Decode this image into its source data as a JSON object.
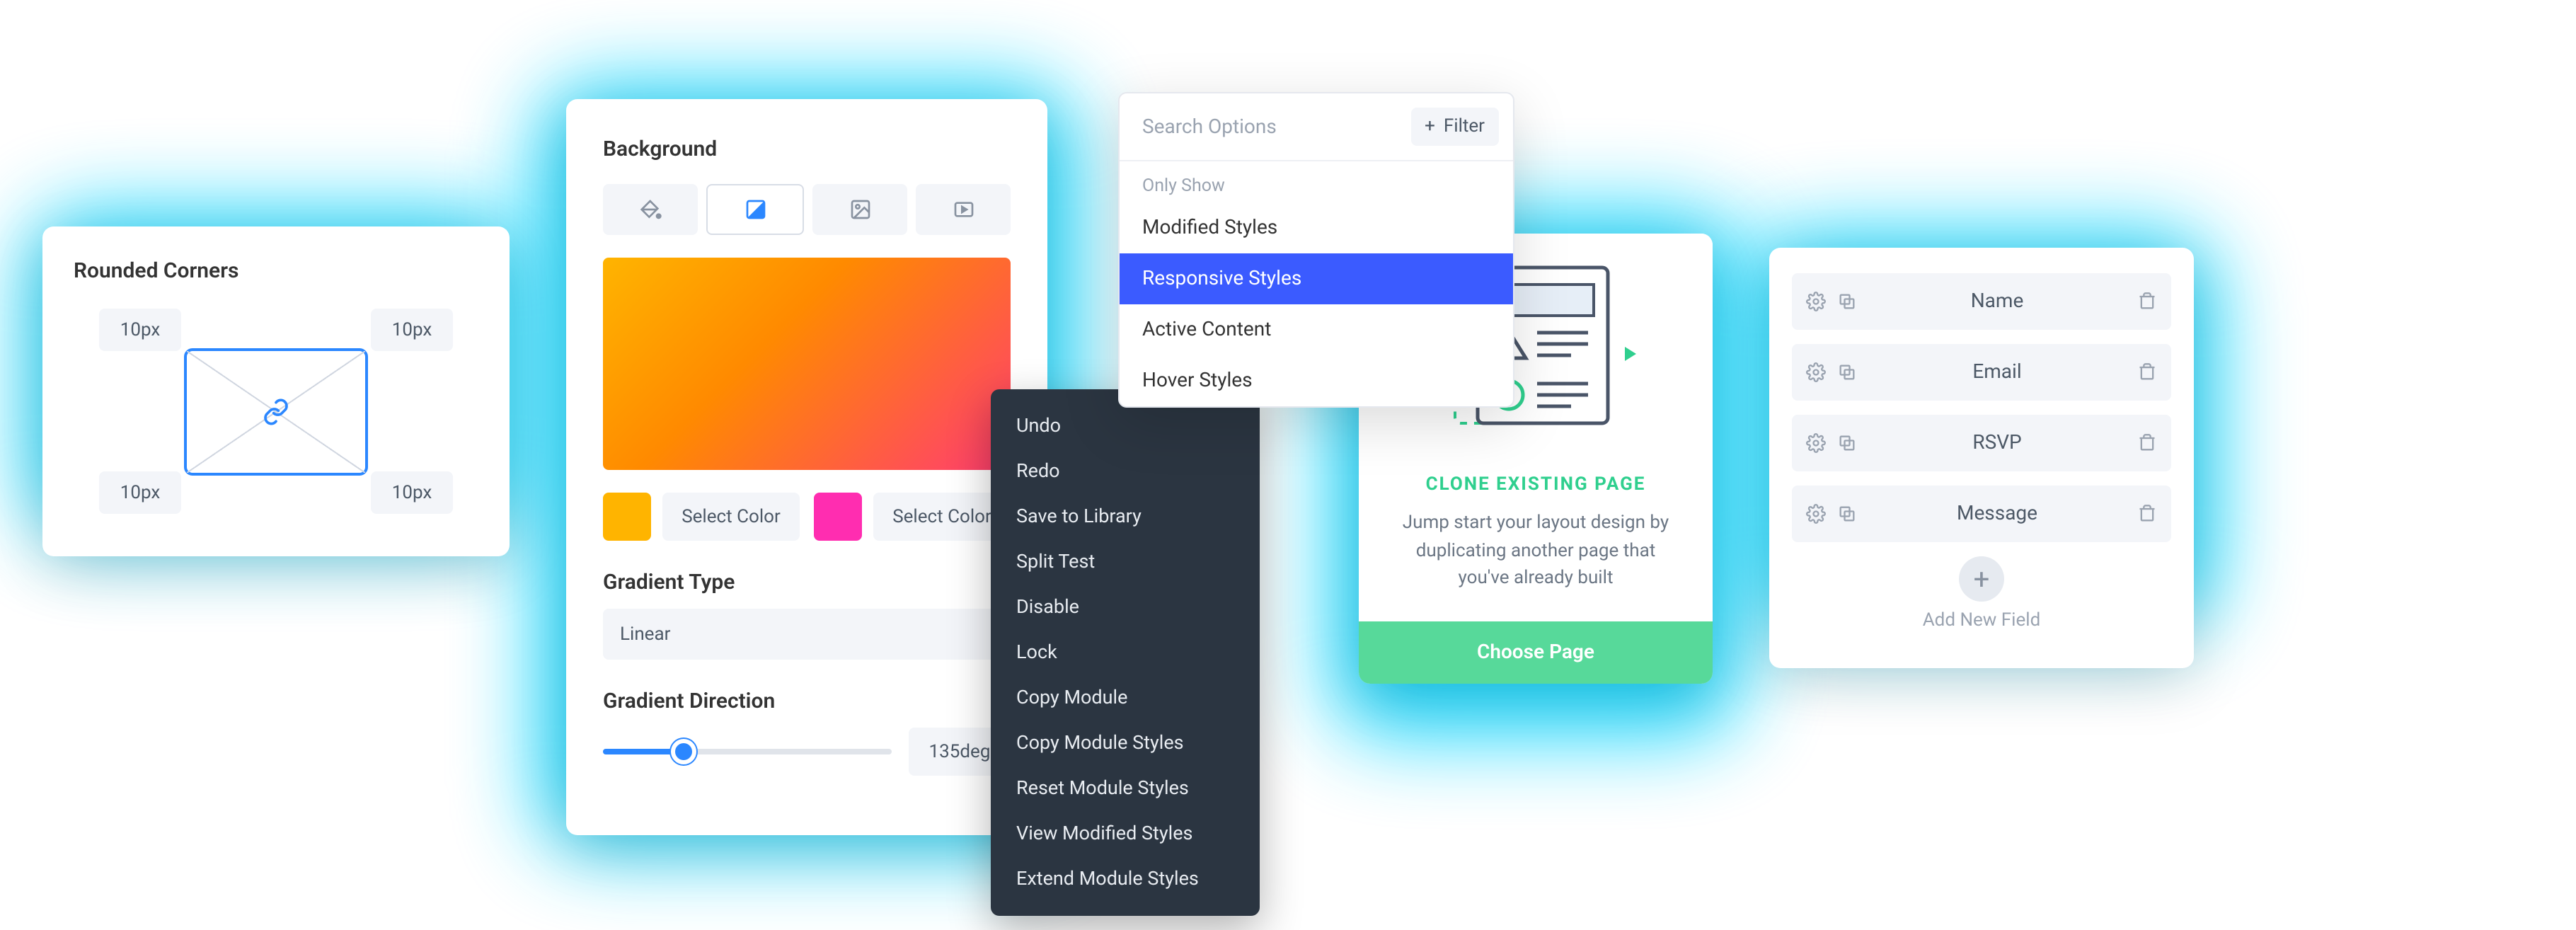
{
  "rounded_corners": {
    "title": "Rounded Corners",
    "tl": "10px",
    "tr": "10px",
    "bl": "10px",
    "br": "10px"
  },
  "background": {
    "title": "Background",
    "color1": "#ffb400",
    "color2": "#ff2db0",
    "select_label": "Select Color",
    "gradient_type_label": "Gradient Type",
    "gradient_type_value": "Linear",
    "gradient_direction_label": "Gradient Direction",
    "gradient_direction_value": "135deg"
  },
  "context_menu": {
    "items": [
      "Undo",
      "Redo",
      "Save to Library",
      "Split Test",
      "Disable",
      "Lock",
      "Copy Module",
      "Copy Module Styles",
      "Reset Module Styles",
      "View Modified Styles",
      "Extend Module Styles"
    ]
  },
  "popover": {
    "search_placeholder": "Search Options",
    "filter_label": "Filter",
    "section_label": "Only Show",
    "items": [
      "Modified Styles",
      "Responsive Styles",
      "Active Content",
      "Hover Styles"
    ],
    "selected_index": 1
  },
  "clone": {
    "title": "CLONE EXISTING PAGE",
    "desc": "Jump start your layout design by duplicating another page that you've already built",
    "button": "Choose Page"
  },
  "fields": {
    "rows": [
      "Name",
      "Email",
      "RSVP",
      "Message"
    ],
    "add_label": "Add New Field"
  }
}
